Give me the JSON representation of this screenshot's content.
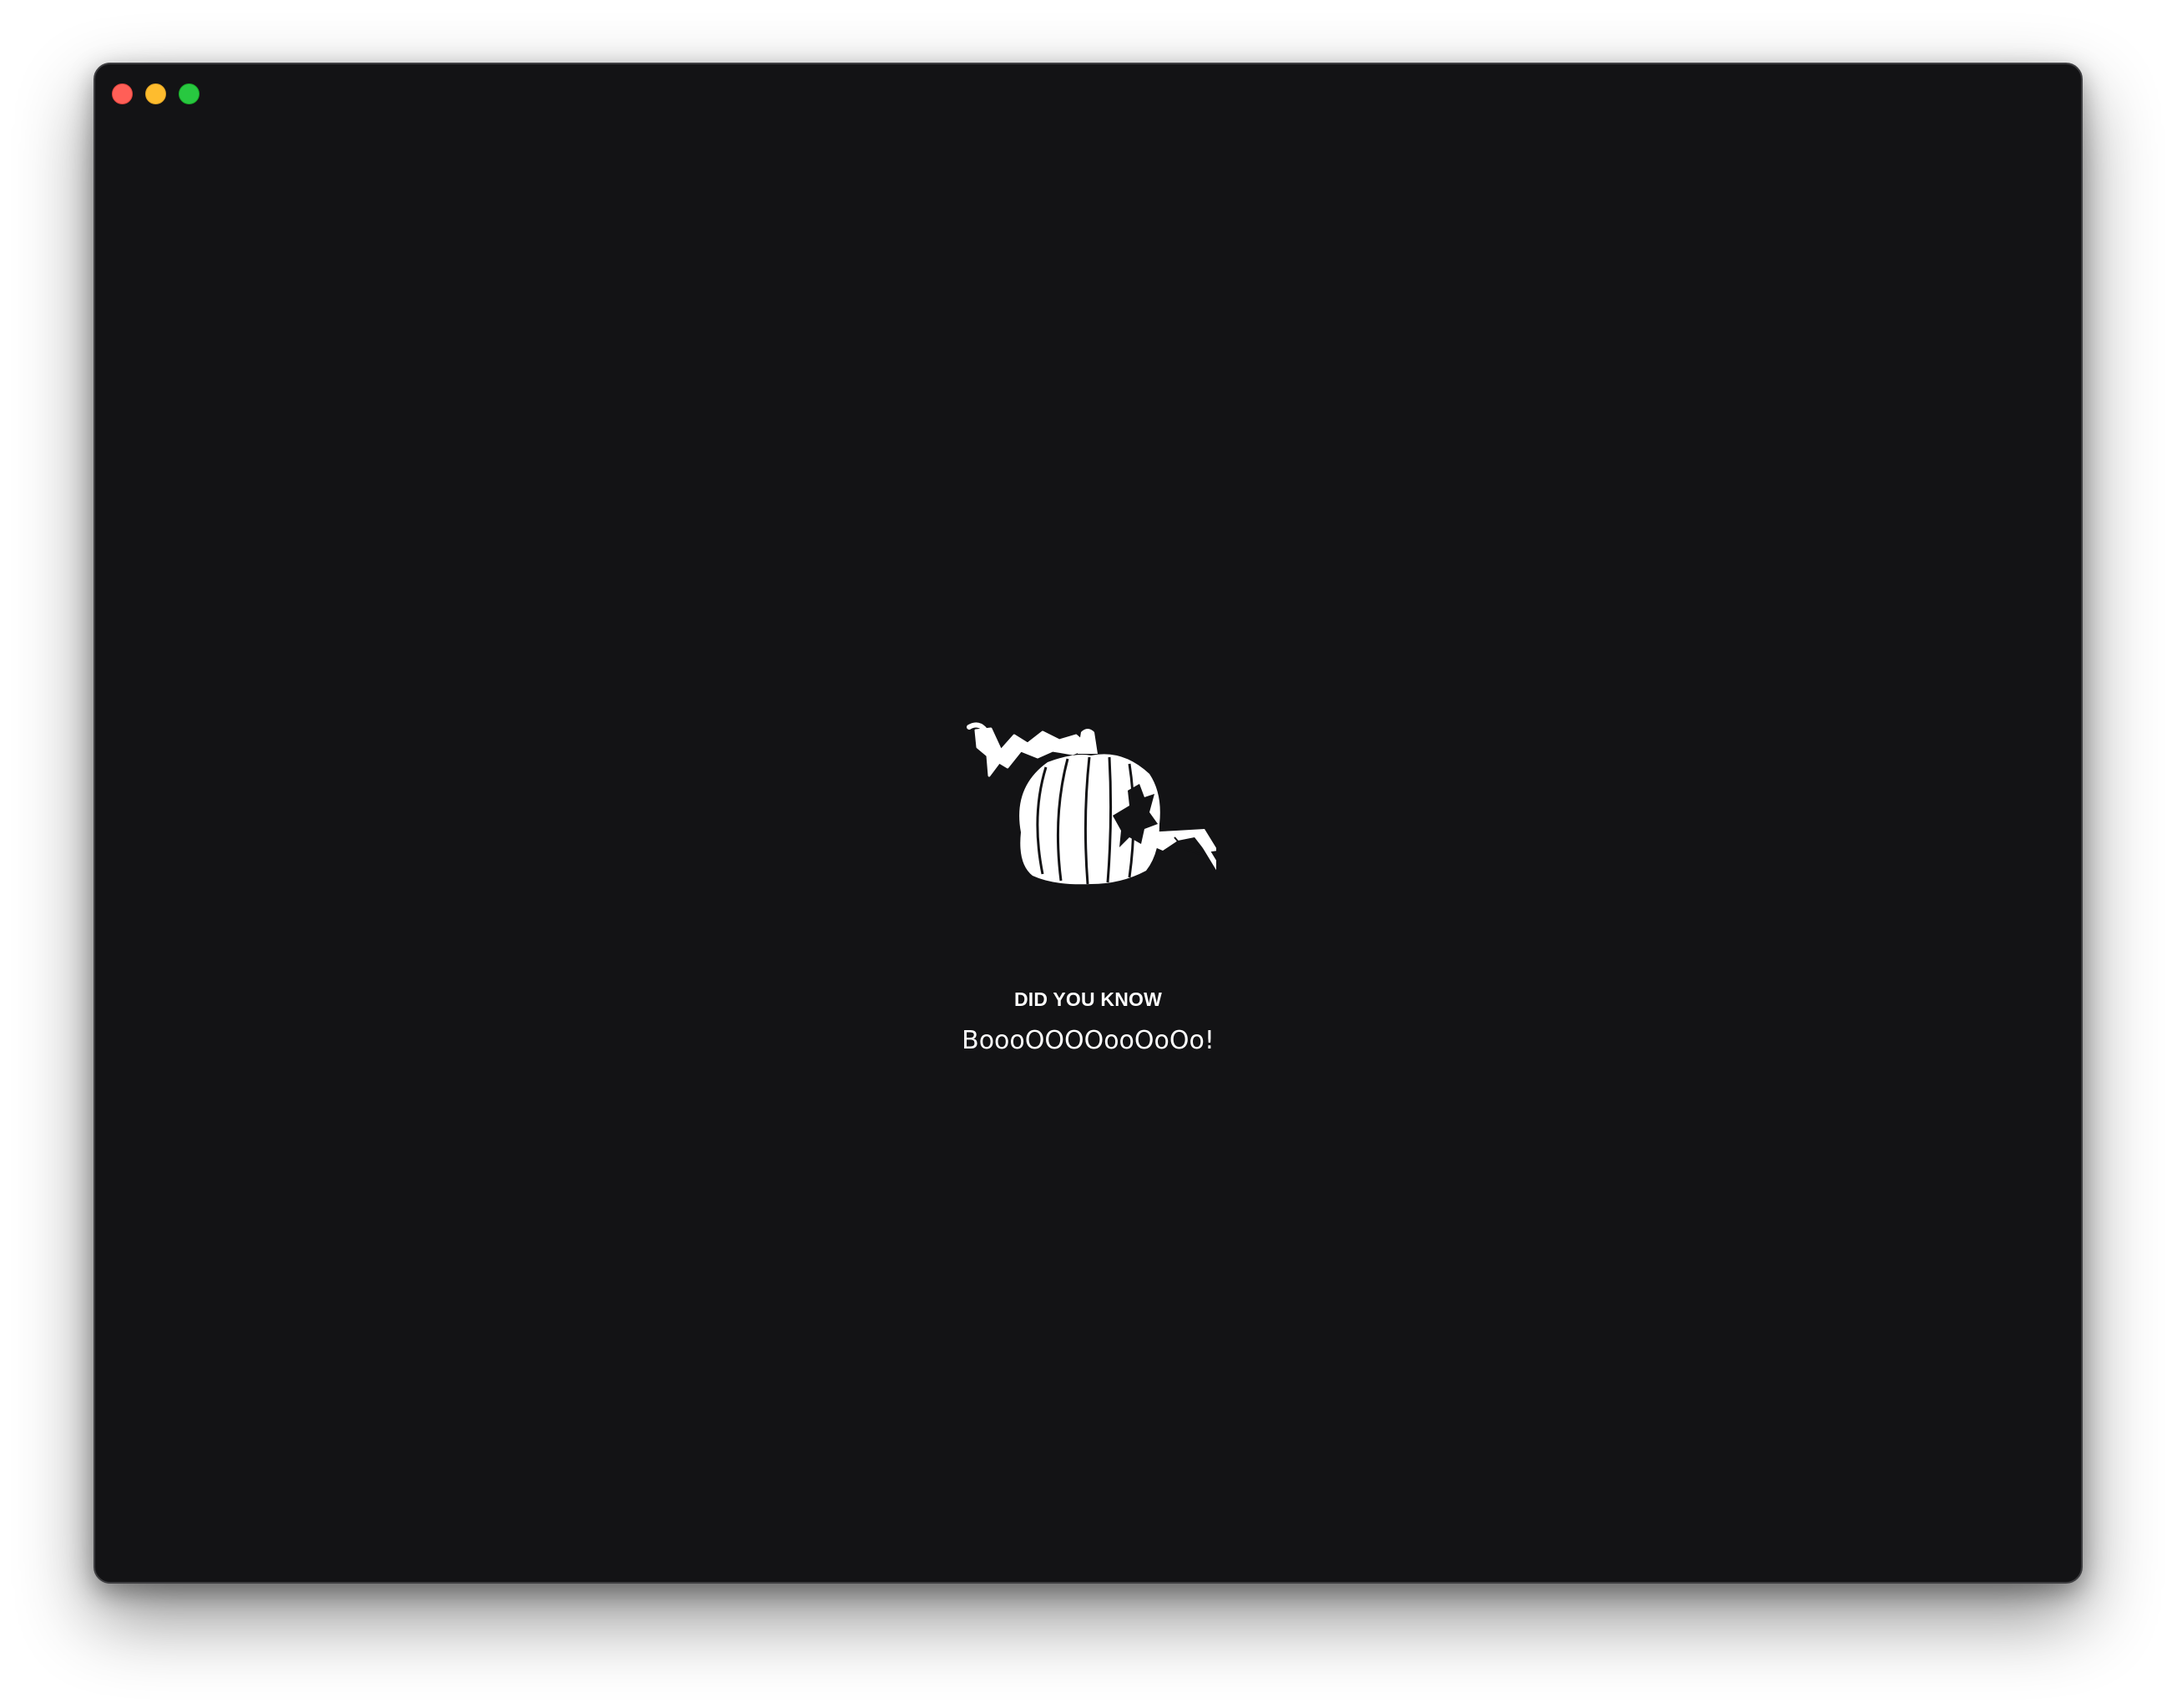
{
  "window": {
    "controls": {
      "close": "close-button",
      "minimize": "minimize-button",
      "zoom": "zoom-button"
    }
  },
  "content": {
    "illustration_icon": "pumpkin-icon",
    "eyebrow": "DID YOU KNOW",
    "message": "BoooOOOOooOoOo!"
  },
  "colors": {
    "window_background": "#131315",
    "text": "#ffffff",
    "close": "#ff5f57",
    "minimize": "#febc2e",
    "zoom": "#28c840"
  }
}
